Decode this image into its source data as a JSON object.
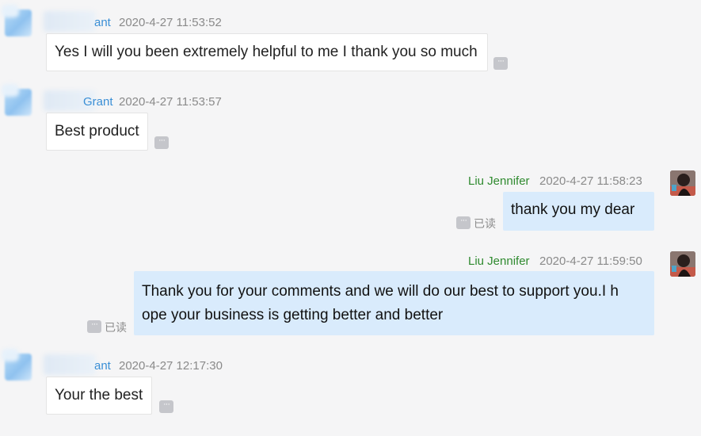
{
  "messages": [
    {
      "sender_partial": "ant",
      "timestamp": "2020-4-27 11:53:52",
      "text": "Yes I will you been extremely helpful to me I thank you so much"
    },
    {
      "sender_partial": "Grant",
      "timestamp": "2020-4-27 11:53:57",
      "text": "Best product"
    },
    {
      "sender": "Liu Jennifer",
      "timestamp": "2020-4-27 11:58:23",
      "text": "thank you my dear",
      "read_status": "已读"
    },
    {
      "sender": "Liu Jennifer",
      "timestamp": "2020-4-27 11:59:50",
      "text_line1": "Thank you for your comments and we will do our best to support you.I h",
      "text_line2": "ope your business is getting better and better",
      "read_status": "已读"
    },
    {
      "sender_partial": "ant",
      "timestamp": "2020-4-27 12:17:30",
      "text": "Your the best"
    }
  ],
  "more_icon": "···",
  "colors": {
    "background": "#f5f5f6",
    "incoming_bubble": "#ffffff",
    "outgoing_bubble": "#d9ebfc",
    "contact_name": "#3a8fd6",
    "own_name": "#2f8a2f",
    "timestamp": "#8a8a8a"
  }
}
